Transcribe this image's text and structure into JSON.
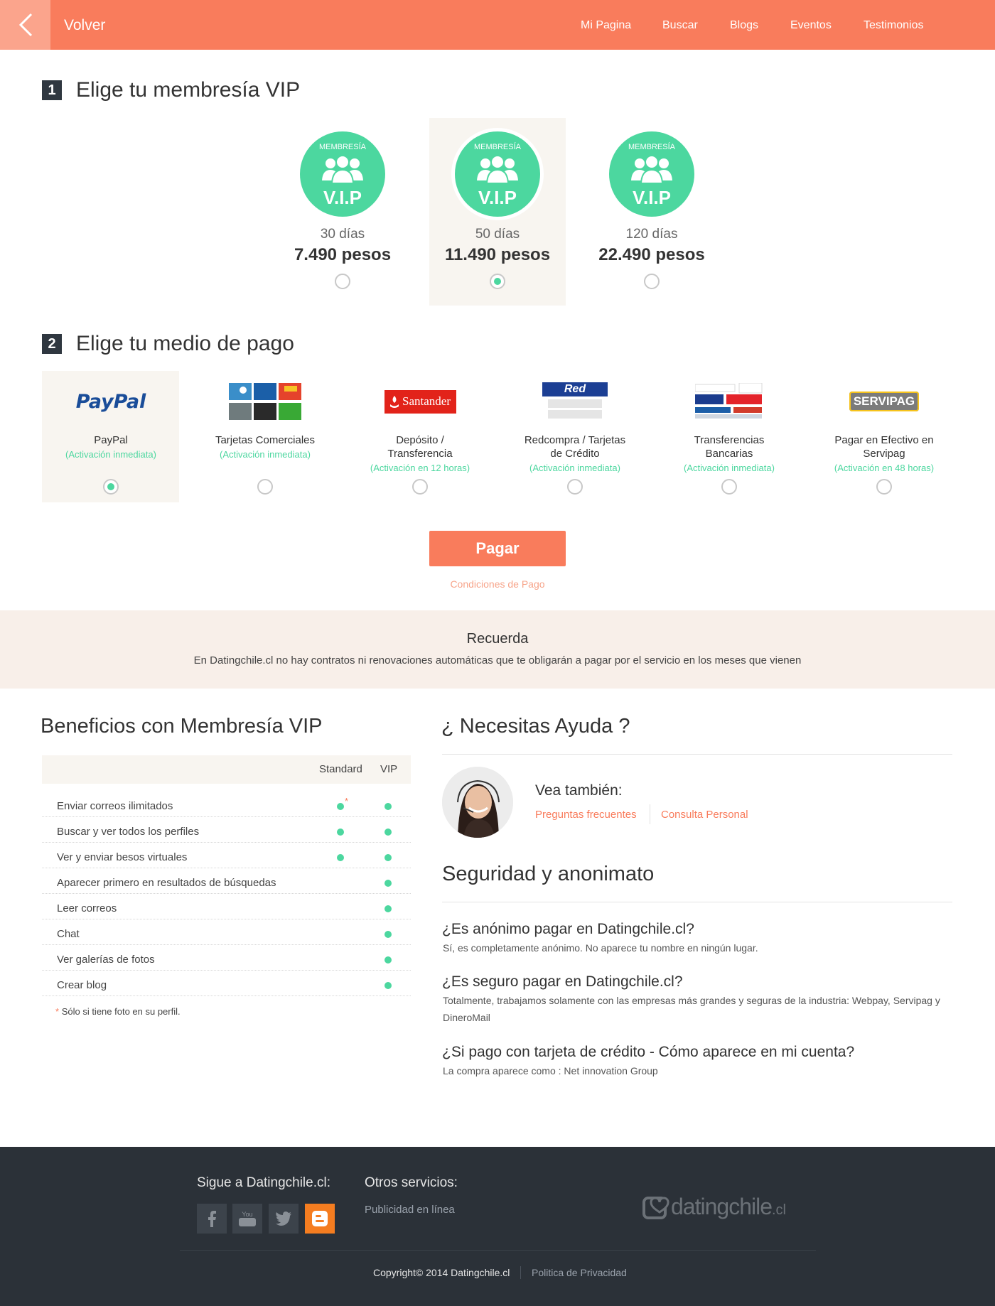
{
  "header": {
    "back_label": "Volver",
    "nav": [
      "Mi Pagina",
      "Buscar",
      "Blogs",
      "Eventos",
      "Testimonios"
    ]
  },
  "step1": {
    "number": "1",
    "title": "Elige tu membresía VIP"
  },
  "vip_badge": {
    "top": "MEMBRESÍA",
    "bottom": "V.I.P"
  },
  "plans": [
    {
      "days": "30 días",
      "price": "7.490  pesos",
      "selected": false
    },
    {
      "days": "50 días",
      "price": "11.490  pesos",
      "selected": true
    },
    {
      "days": "120 días",
      "price": "22.490  pesos",
      "selected": false
    }
  ],
  "step2": {
    "number": "2",
    "title": "Elige tu medio de pago"
  },
  "payments": [
    {
      "logo": "PayPal",
      "name": "PayPal",
      "activation": "(Activación inmediata)",
      "selected": true
    },
    {
      "logo": "",
      "name": "Tarjetas Comerciales",
      "activation": "(Activación inmediata)",
      "selected": false
    },
    {
      "logo": "Santander",
      "name": "Depósito / Transferencia",
      "activation": "(Activación en 12 horas)",
      "selected": false
    },
    {
      "logo": "Red compra",
      "name": "Redcompra / Tarjetas de Crédito",
      "activation": "(Activación inmediata)",
      "selected": false
    },
    {
      "logo": "",
      "name": "Transferencias Bancarias",
      "activation": "(Activación inmediata)",
      "selected": false
    },
    {
      "logo": "SERVIPAG",
      "name": "Pagar en Efectivo en Servipag",
      "activation": "(Activación en 48 horas)",
      "selected": false
    }
  ],
  "pay_button": "Pagar",
  "conditions_link": "Condiciones de Pago",
  "remember": {
    "title": "Recuerda",
    "text": "En Datingchile.cl no hay contratos ni renovaciones automáticas que te obligarán a pagar por el servicio en los meses que vienen"
  },
  "benefits": {
    "title": "Beneficios con Membresía VIP",
    "col_standard": "Standard",
    "col_vip": "VIP",
    "rows": [
      {
        "label": "Enviar correos ilimitados",
        "standard": true,
        "vip": true
      },
      {
        "label": "Buscar y ver todos los perfiles",
        "standard": true,
        "vip": true
      },
      {
        "label": "Ver y enviar besos virtuales",
        "standard": true,
        "vip": true
      },
      {
        "label": "Aparecer primero en resultados de búsquedas",
        "standard": false,
        "vip": true
      },
      {
        "label": "Leer correos",
        "standard": false,
        "vip": true
      },
      {
        "label": "Chat",
        "standard": false,
        "vip": true
      },
      {
        "label": "Ver galerías de fotos",
        "standard": false,
        "vip": true
      },
      {
        "label": "Crear blog",
        "standard": false,
        "vip": true
      }
    ],
    "asterisk": "*",
    "note": "Sólo si tiene foto en su perfil."
  },
  "help": {
    "title": "¿ Necesitas Ayuda ?",
    "see_also": "Vea también:",
    "link_faq": "Preguntas frecuentes",
    "link_personal": "Consulta Personal"
  },
  "security": {
    "title": "Seguridad y anonimato",
    "items": [
      {
        "q": "¿Es anónimo pagar en Datingchile.cl?",
        "a": "Sí, es completamente anónimo. No aparece tu nombre en ningún lugar."
      },
      {
        "q": "¿Es seguro pagar en Datingchile.cl?",
        "a": "Totalmente, trabajamos solamente con las empresas más grandes y seguras de la industria: Webpay, Servipag y DineroMail"
      },
      {
        "q": "¿Si pago con tarjeta de crédito - Cómo aparece en mi cuenta?",
        "a": "La compra aparece como : Net innovation Group"
      }
    ]
  },
  "footer": {
    "follow_title": "Sigue a Datingchile.cl:",
    "other_title": "Otros servicios:",
    "other_link": "Publicidad en línea",
    "logo_text": "datingchile",
    "logo_suffix": ".cl",
    "copyright": "Copyright© 2014  Datingchile.cl",
    "privacy": "Politica de Privacidad"
  },
  "colors": {
    "accent": "#f97c5c",
    "green": "#4cd79f",
    "dark": "#2b3138",
    "beige": "#f8f5f0"
  }
}
